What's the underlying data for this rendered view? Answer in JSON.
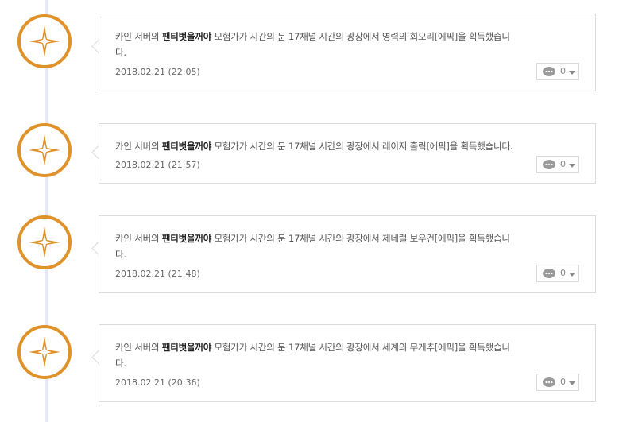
{
  "colors": {
    "badge_orange": "#e0922a",
    "timeline_line": "#e6e9f5",
    "card_border": "#dcdcdc"
  },
  "entries": [
    {
      "pre": "카인 서버의 ",
      "character": "팬티벗을꺼야",
      "post_line1": " 모험가가 시간의 문 17채널 시간의 광장에서 영력의 회오리[에픽]을 획득했습니",
      "post_line2": "다.",
      "date": "2018.02.21 (22:05)",
      "comments": "0",
      "icon": "compass-star-icon"
    },
    {
      "pre": "카인 서버의 ",
      "character": "팬티벗을꺼야",
      "post_line1": " 모험가가 시간의 문 17채널 시간의 광장에서 레이저 홀릭[에픽]을 획득했습니다.",
      "post_line2": "",
      "date": "2018.02.21 (21:57)",
      "comments": "0",
      "icon": "compass-star-icon"
    },
    {
      "pre": "카인 서버의 ",
      "character": "팬티벗을꺼야",
      "post_line1": " 모험가가 시간의 문 17채널 시간의 광장에서 제네럴 보우건[에픽]을 획득했습니",
      "post_line2": "다.",
      "date": "2018.02.21 (21:48)",
      "comments": "0",
      "icon": "compass-star-icon"
    },
    {
      "pre": "카인 서버의 ",
      "character": "팬티벗을꺼야",
      "post_line1": " 모험가가 시간의 문 17채널 시간의 광장에서 세계의 무게추[에픽]을 획득했습니",
      "post_line2": "다.",
      "date": "2018.02.21 (20:36)",
      "comments": "0",
      "icon": "compass-star-icon"
    }
  ]
}
